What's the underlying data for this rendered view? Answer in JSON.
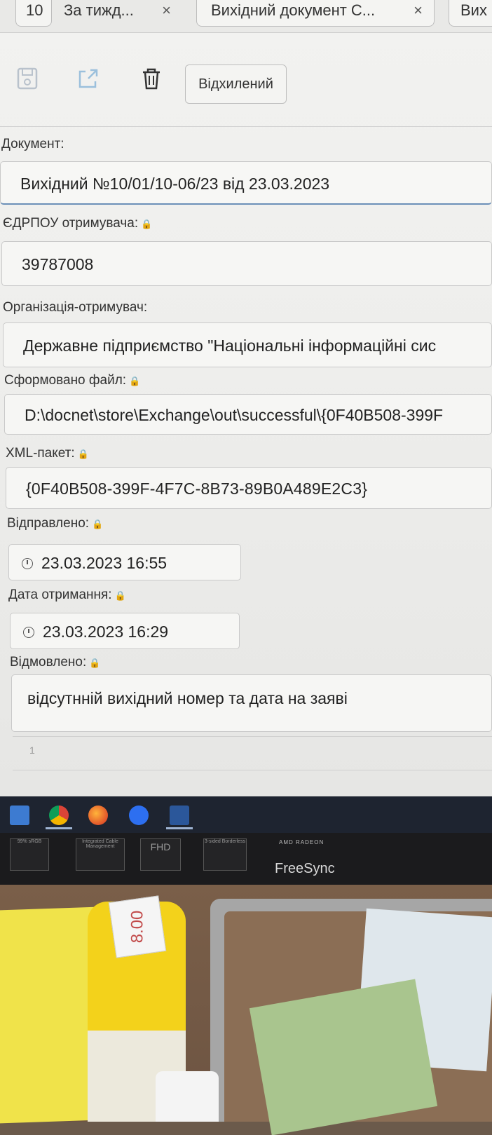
{
  "tabs": [
    {
      "label": "10"
    },
    {
      "label": "За тижд...",
      "close": "×"
    },
    {
      "label": "Вихідний документ С...",
      "close": "×"
    },
    {
      "label": "Вих"
    }
  ],
  "toolbar": {
    "status_label": "Відхилений"
  },
  "form": {
    "document": {
      "label": "Документ:",
      "value": "Вихідний №10/01/10-06/23 від 23.03.2023"
    },
    "edrpou": {
      "label": "ЄДРПОУ отримувача:",
      "value": "39787008"
    },
    "org": {
      "label": "Організація-отримувач:",
      "value": "Державне підприємство \"Національні інформаційні сис"
    },
    "file": {
      "label": "Сформовано файл:",
      "value": "D:\\docnet\\store\\Exchange\\out\\successful\\{0F40B508-399F"
    },
    "xml": {
      "label": "XML-пакет:",
      "value": "{0F40B508-399F-4F7C-8B73-89B0A489E2C3}"
    },
    "sent": {
      "label": "Відправлено:",
      "value": "23.03.2023 16:55"
    },
    "received": {
      "label": "Дата отримання:",
      "value": "23.03.2023 16:29"
    },
    "rejected": {
      "label": "Відмовлено:",
      "value": "відсутнній вихідний номер та дата на заяві"
    },
    "line_number": "1"
  },
  "monitor": {
    "brand_small": "AMD RADEON",
    "brand_large": "FreeSync",
    "stickers": [
      "99% sRGB",
      "Integrated Cable Management",
      "FHD",
      "3-sided Borderless"
    ]
  },
  "desk": {
    "price_tag": "8.00"
  },
  "colors": {
    "screen_bg": "#efefed",
    "taskbar": "#1e2430",
    "accent_underline": "#6b8fb8"
  }
}
